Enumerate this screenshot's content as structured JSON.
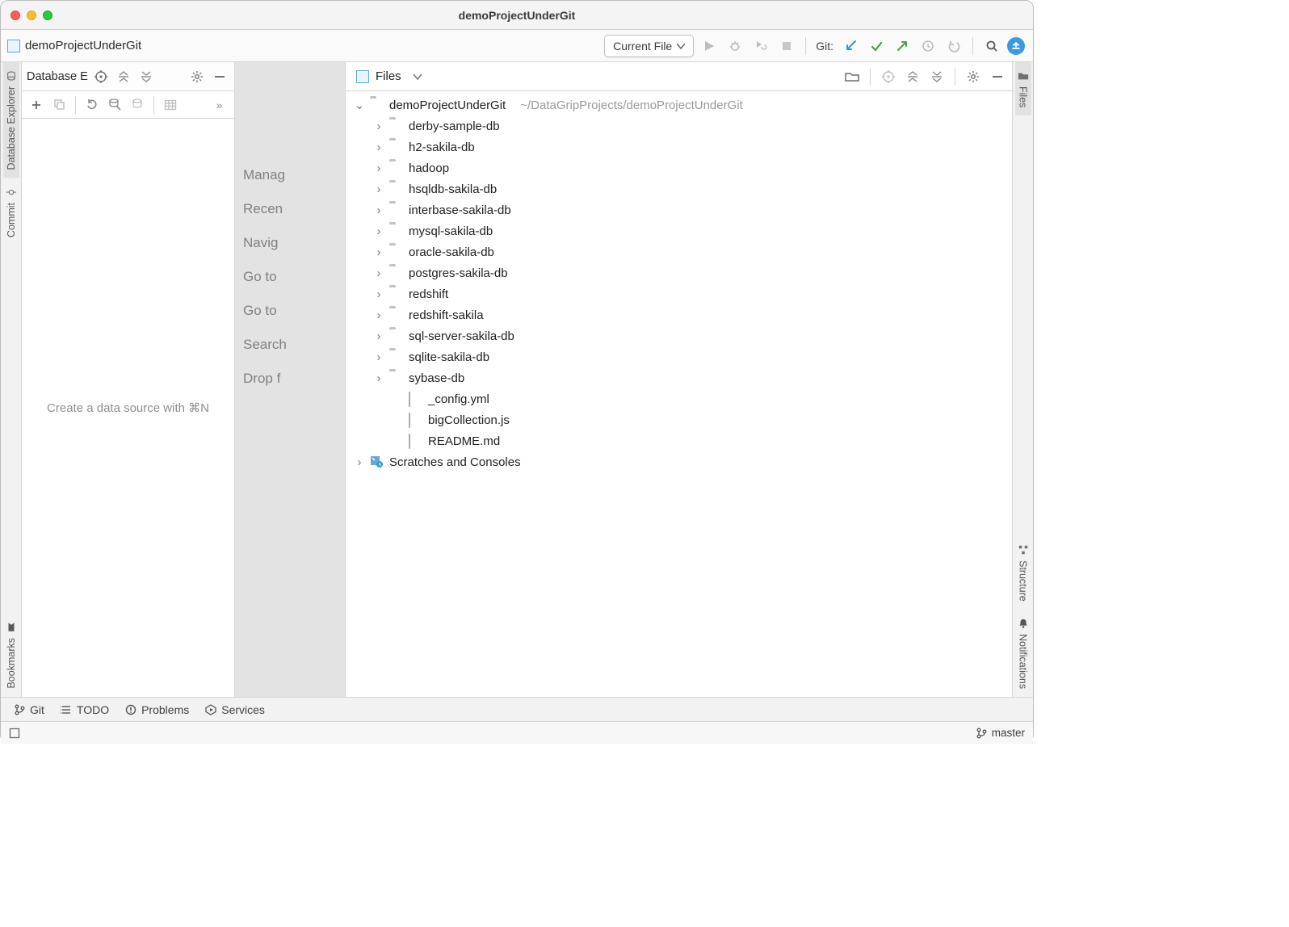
{
  "window": {
    "title": "demoProjectUnderGit"
  },
  "breadcrumb": {
    "project": "demoProjectUnderGit"
  },
  "toolbar": {
    "run_config_label": "Current File",
    "git_label": "Git:"
  },
  "left_stripe": {
    "db_explorer": "Database Explorer",
    "commit": "Commit",
    "bookmarks": "Bookmarks"
  },
  "right_stripe": {
    "files": "Files",
    "structure": "Structure",
    "notifications": "Notifications"
  },
  "db_panel": {
    "title": "Database E",
    "empty_hint": "Create a data source with ⌘N"
  },
  "center_hints": {
    "l0": "Manag",
    "l1": "Recen",
    "l2": "Navig",
    "l3": "Go to",
    "l4": "Go to",
    "l5": "Search",
    "l6": "Drop f"
  },
  "files_panel": {
    "title": "Files",
    "root": {
      "name": "demoProjectUnderGit",
      "path": "~/DataGripProjects/demoProjectUnderGit"
    },
    "folders": [
      "derby-sample-db",
      "h2-sakila-db",
      "hadoop",
      "hsqldb-sakila-db",
      "interbase-sakila-db",
      "mysql-sakila-db",
      "oracle-sakila-db",
      "postgres-sakila-db",
      "redshift",
      "redshift-sakila",
      "sql-server-sakila-db",
      "sqlite-sakila-db",
      "sybase-db"
    ],
    "files": [
      "_config.yml",
      "bigCollection.js",
      "README.md"
    ],
    "scratches": "Scratches and Consoles"
  },
  "bottom_tabs": {
    "git": "Git",
    "todo": "TODO",
    "problems": "Problems",
    "services": "Services"
  },
  "statusbar": {
    "branch": "master"
  }
}
